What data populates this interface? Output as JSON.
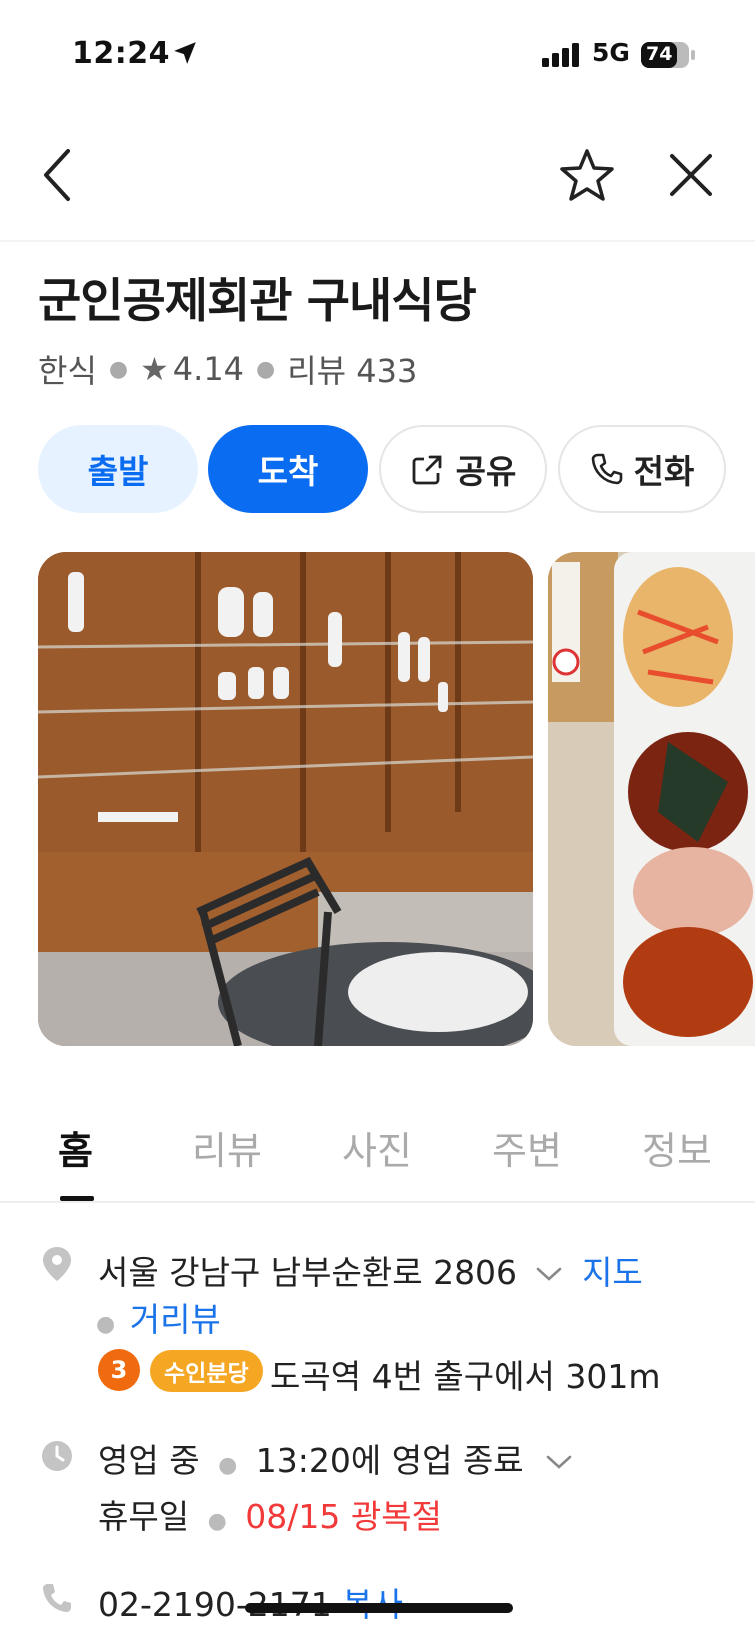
{
  "status_bar": {
    "time": "12:24",
    "network": "5G",
    "battery": "74"
  },
  "place": {
    "name": "군인공제회관 구내식당",
    "category": "한식",
    "rating": "4.14",
    "review_label": "리뷰 433"
  },
  "actions": {
    "depart": "출발",
    "arrive": "도착",
    "share": "공유",
    "call": "전화"
  },
  "tabs": [
    "홈",
    "리뷰",
    "사진",
    "주변",
    "정보"
  ],
  "info": {
    "address": "서울 강남구 남부순환로 2806",
    "map_link": "지도",
    "street_view_link": "거리뷰",
    "subway_line_number": "3",
    "subway_line_name": "수인분당",
    "subway_direction": "도곡역 4번 출구에서 301m",
    "hours_status": "영업 중",
    "hours_close": "13:20에 영업 종료",
    "holiday_label": "휴무일",
    "holiday_value": "08/15 광복절",
    "phone": "02-2190-2171",
    "copy_label": "복사"
  },
  "colors": {
    "accent": "#0a6cf0",
    "holiday": "#f23a3a",
    "subway_3": "#f06b0f",
    "subway_suin": "#f5a623"
  }
}
